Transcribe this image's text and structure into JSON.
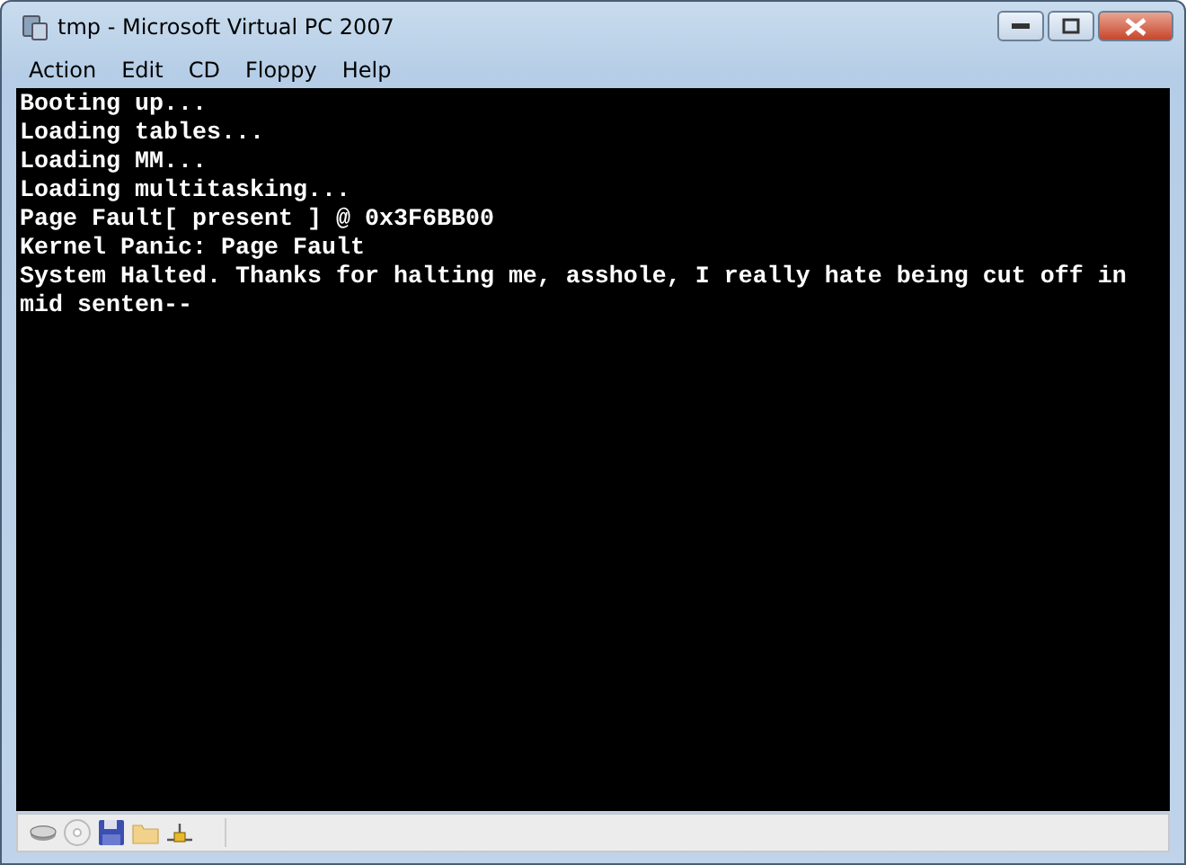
{
  "window": {
    "title": "tmp - Microsoft Virtual PC 2007"
  },
  "menu": [
    "Action",
    "Edit",
    "CD",
    "Floppy",
    "Help"
  ],
  "console": {
    "lines": [
      "Booting up...",
      "Loading tables...",
      "Loading MM...",
      "Loading multitasking...",
      "Page Fault[ present ] @ 0x3F6BB00",
      "Kernel Panic: Page Fault",
      "System Halted. Thanks for halting me, asshole, I really hate being cut off in",
      "mid senten--"
    ]
  },
  "status_bar": {
    "icons": [
      {
        "kind": "disk"
      },
      {
        "kind": "cd"
      },
      {
        "kind": "floppy"
      },
      {
        "kind": "folder"
      },
      {
        "kind": "network"
      }
    ]
  }
}
